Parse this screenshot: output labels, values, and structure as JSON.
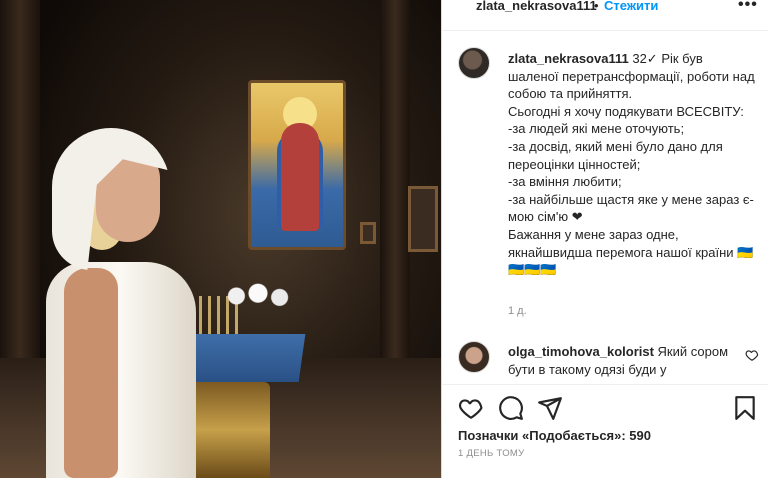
{
  "header": {
    "username": "zlata_nekrasova111",
    "separator": "•",
    "follow_label": "Стежити",
    "more_label": "•••"
  },
  "caption": {
    "username": "zlata_nekrasova111",
    "edited_mark": "32✓",
    "text": "Рік був шаленої перетрансформації, роботи над собою та прийняття.\nСьогодні я хочу подякувати ВСЕСВІТУ:\n-за людей які мене оточують;\n-за досвід, який мені було дано для переоцінки цінностей;\n-за вміння любити;\n-за найбільше щастя яке у мене зараз є-мою сім'ю ❤\nБажання у мене зараз одне, якнайшвидша перемога нашої країни 🇺🇦🇺🇦🇺🇦🇺🇦",
    "time": "1 д."
  },
  "comment": {
    "username": "olga_timohova_kolorist",
    "text": "Який сором бути в такому одязі буди у"
  },
  "actions": {
    "like_icon": "heart-icon",
    "comment_icon": "comment-icon",
    "share_icon": "paper-plane-icon",
    "save_icon": "bookmark-icon"
  },
  "likes_label": "Позначки «Подобається»: 590",
  "date_label": "1 ДЕНЬ ТОМУ",
  "colors": {
    "link_blue": "#0095f6",
    "text": "#262626",
    "muted": "#8e8e8e",
    "border": "#dbdbdb"
  }
}
